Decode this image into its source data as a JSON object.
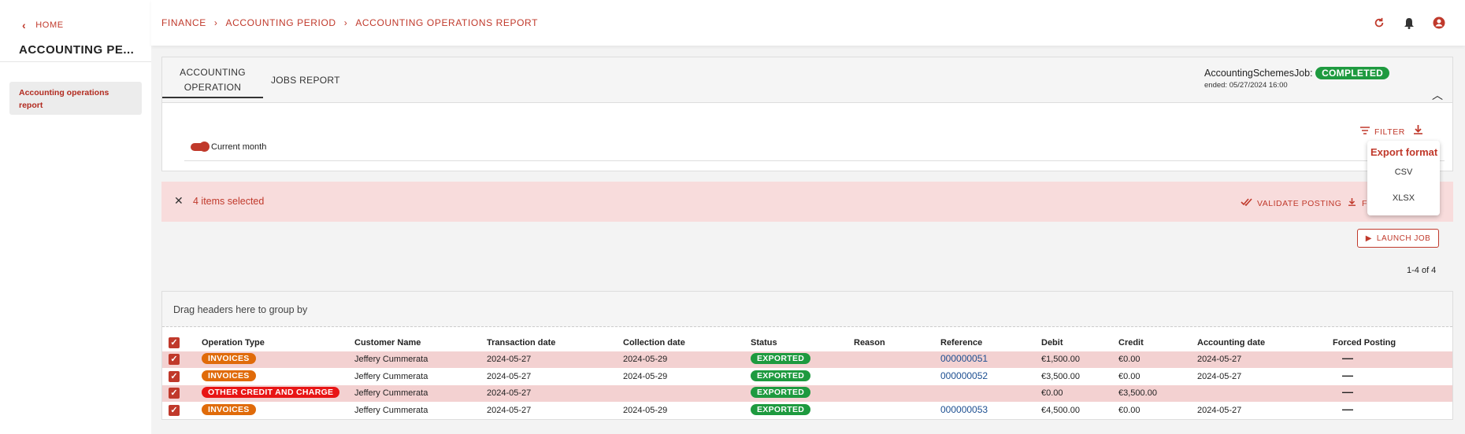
{
  "sidebar": {
    "home_label": "HOME",
    "title": "ACCOUNTING PE...",
    "items": [
      {
        "label": "Accounting operations report"
      }
    ]
  },
  "topbar": {
    "breadcrumb": [
      "FINANCE",
      "ACCOUNTING PERIOD",
      "ACCOUNTING OPERATIONS REPORT"
    ],
    "icons": [
      "refresh-icon",
      "bell-icon",
      "account-icon"
    ]
  },
  "tabs": [
    {
      "label": "ACCOUNTING OPERATION"
    },
    {
      "label": "JOBS REPORT"
    }
  ],
  "job": {
    "name": "AccountingSchemesJob:",
    "status": "COMPLETED",
    "ended": "ended: 05/27/2024 16:00"
  },
  "filters": {
    "filter_label": "FILTER",
    "toggle_label": "Current month"
  },
  "export_menu": {
    "title": "Export format",
    "options": [
      "CSV",
      "XLSX"
    ]
  },
  "selection": {
    "text": "4 items selected",
    "validate_label": "VALIDATE POSTING",
    "export_label": "F"
  },
  "launch_label": "LAUNCH JOB",
  "pager": "1-4 of 4",
  "grid": {
    "group_hint": "Drag headers here to group by",
    "columns": [
      "Operation Type",
      "Customer Name",
      "Transaction date",
      "Collection date",
      "Status",
      "Reason",
      "Reference",
      "Debit",
      "Credit",
      "Accounting date",
      "Forced Posting"
    ],
    "rows": [
      {
        "type": "INVOICES",
        "customer": "Jeffery Cummerata",
        "tx_date": "2024-05-27",
        "coll_date": "2024-05-29",
        "status": "EXPORTED",
        "reason": "",
        "ref": "000000051",
        "debit": "€1,500.00",
        "credit": "€0.00",
        "acc_date": "2024-05-27",
        "forced": "—"
      },
      {
        "type": "INVOICES",
        "customer": "Jeffery Cummerata",
        "tx_date": "2024-05-27",
        "coll_date": "2024-05-29",
        "status": "EXPORTED",
        "reason": "",
        "ref": "000000052",
        "debit": "€3,500.00",
        "credit": "€0.00",
        "acc_date": "2024-05-27",
        "forced": "—"
      },
      {
        "type": "OTHER CREDIT AND CHARGE",
        "customer": "Jeffery Cummerata",
        "tx_date": "2024-05-27",
        "coll_date": "",
        "status": "EXPORTED",
        "reason": "",
        "ref": "",
        "debit": "€0.00",
        "credit": "€3,500.00",
        "acc_date": "",
        "forced": "—"
      },
      {
        "type": "INVOICES",
        "customer": "Jeffery Cummerata",
        "tx_date": "2024-05-27",
        "coll_date": "2024-05-29",
        "status": "EXPORTED",
        "reason": "",
        "ref": "000000053",
        "debit": "€4,500.00",
        "credit": "€0.00",
        "acc_date": "2024-05-27",
        "forced": "—"
      }
    ]
  },
  "colors": {
    "accent": "#c0392b",
    "selected_row": "#f3d1d1",
    "success": "#1e9a3f",
    "invoice": "#e06b0a",
    "other": "#e81515"
  }
}
